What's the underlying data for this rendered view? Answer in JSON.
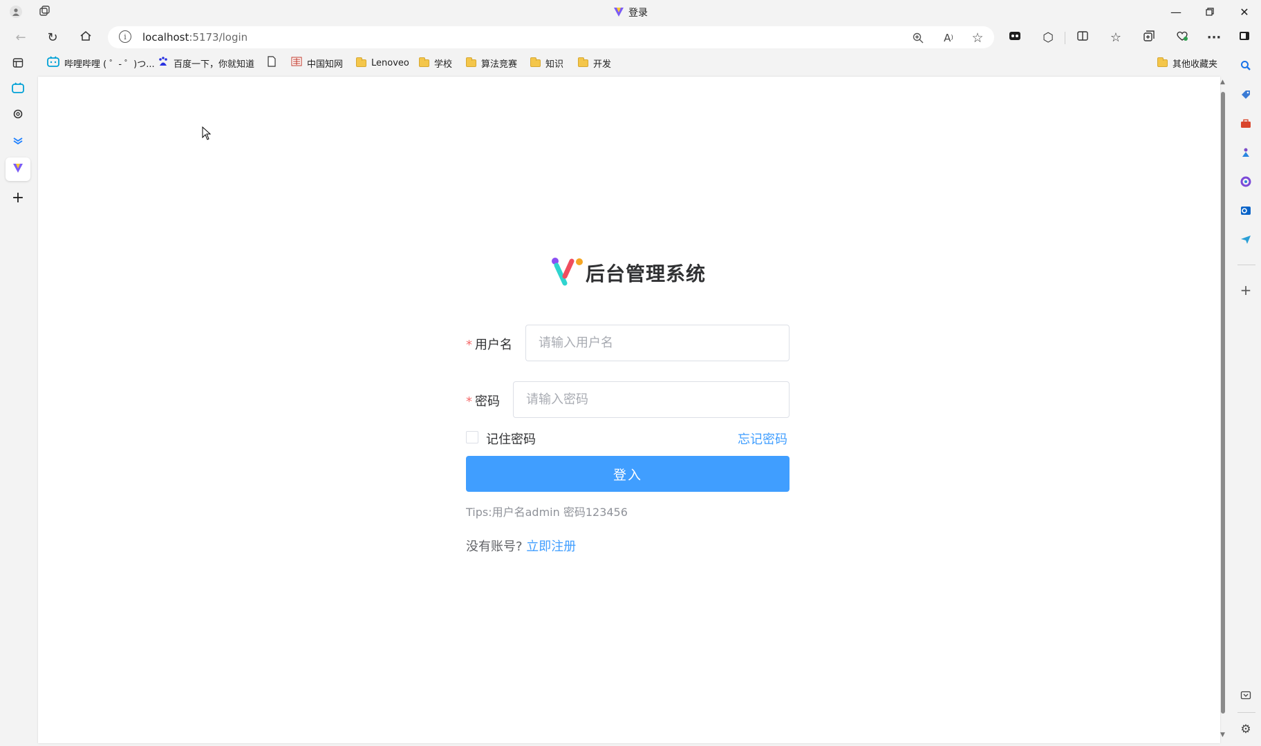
{
  "browser": {
    "tab_title": "登录",
    "url_host": "localhost",
    "url_path": ":5173/login",
    "window_controls": [
      "minimize-icon",
      "restore-icon",
      "close-icon"
    ]
  },
  "bookmarks": {
    "items": [
      {
        "label": "哔哩哔哩 ( ゜- ゜)つ...",
        "icon": "bilibili-icon"
      },
      {
        "label": "百度一下，你就知道",
        "icon": "baidu-icon"
      },
      {
        "label": "",
        "icon": "page-icon"
      },
      {
        "label": "中国知网",
        "icon": "cnki-icon"
      },
      {
        "label": "Lenoveo",
        "icon": "folder-icon"
      },
      {
        "label": "学校",
        "icon": "folder-icon"
      },
      {
        "label": "算法竞赛",
        "icon": "folder-icon"
      },
      {
        "label": "知识",
        "icon": "folder-icon"
      },
      {
        "label": "开发",
        "icon": "folder-icon"
      }
    ],
    "other": "其他收藏夹"
  },
  "login": {
    "app_title": "后台管理系统",
    "required_mark": "*",
    "username_label": "用户名",
    "username_placeholder": "请输入用户名",
    "username_value": "",
    "password_label": "密码",
    "password_placeholder": "请输入密码",
    "password_value": "",
    "remember_label": "记住密码",
    "remember_checked": false,
    "forgot_link": "忘记密码",
    "login_button": "登入",
    "tips": "Tips:用户名admin 密码123456",
    "no_account": "没有账号?",
    "register_link": "立即注册"
  },
  "colors": {
    "primary": "#409eff",
    "required": "#f56c6c",
    "page_bg": "#ffffff",
    "chrome_bg": "#f3f3f3"
  }
}
